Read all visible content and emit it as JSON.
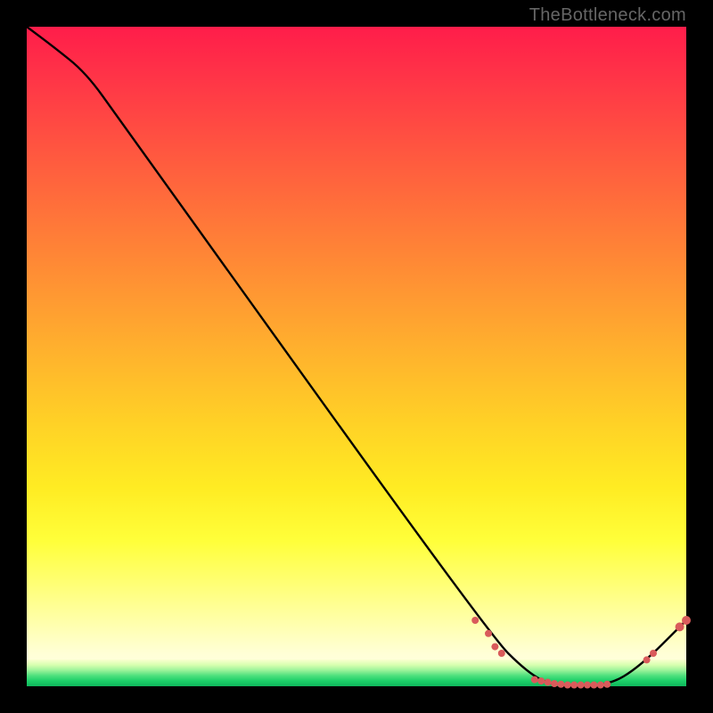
{
  "watermark": "TheBottleneck.com",
  "chart_data": {
    "type": "line",
    "title": "",
    "xlabel": "",
    "ylabel": "",
    "xlim": [
      0,
      100
    ],
    "ylim": [
      0,
      100
    ],
    "grid": false,
    "legend": false,
    "curve": {
      "name": "bottleneck-curve",
      "color": "#000000",
      "points": [
        {
          "x": 0,
          "y": 100
        },
        {
          "x": 4,
          "y": 97
        },
        {
          "x": 9,
          "y": 93
        },
        {
          "x": 14,
          "y": 86
        },
        {
          "x": 70,
          "y": 8
        },
        {
          "x": 76,
          "y": 2
        },
        {
          "x": 80,
          "y": 0
        },
        {
          "x": 88,
          "y": 0
        },
        {
          "x": 93,
          "y": 3
        },
        {
          "x": 100,
          "y": 10
        }
      ]
    },
    "markers": {
      "color": "#d95b5b",
      "radius_small": 4,
      "radius_big": 5,
      "points": [
        {
          "x": 68,
          "y": 10
        },
        {
          "x": 70,
          "y": 8
        },
        {
          "x": 71,
          "y": 6
        },
        {
          "x": 72,
          "y": 5
        },
        {
          "x": 77,
          "y": 1
        },
        {
          "x": 78,
          "y": 0.8
        },
        {
          "x": 79,
          "y": 0.6
        },
        {
          "x": 80,
          "y": 0.4
        },
        {
          "x": 81,
          "y": 0.3
        },
        {
          "x": 82,
          "y": 0.2
        },
        {
          "x": 83,
          "y": 0.2
        },
        {
          "x": 84,
          "y": 0.2
        },
        {
          "x": 85,
          "y": 0.2
        },
        {
          "x": 86,
          "y": 0.2
        },
        {
          "x": 87,
          "y": 0.2
        },
        {
          "x": 88,
          "y": 0.3
        },
        {
          "x": 94,
          "y": 4
        },
        {
          "x": 95,
          "y": 5
        },
        {
          "x": 99,
          "y": 9,
          "big": true
        },
        {
          "x": 100,
          "y": 10,
          "big": true
        }
      ]
    }
  }
}
